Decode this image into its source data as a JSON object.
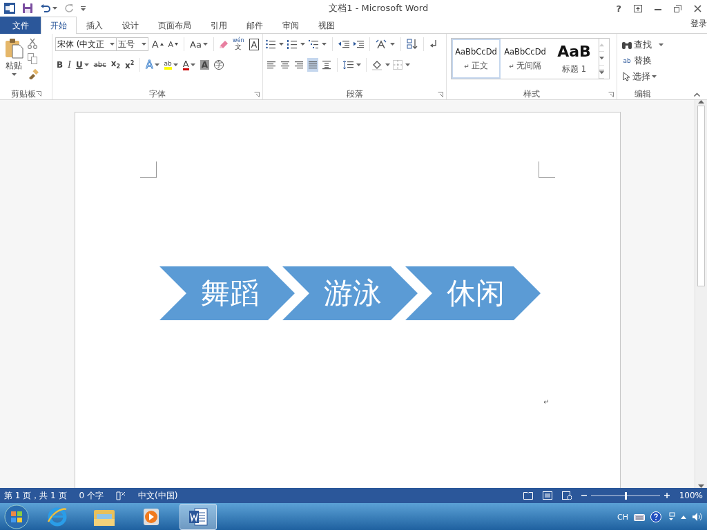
{
  "title_bar": {
    "title": "文档1 - Microsoft Word",
    "help": "?"
  },
  "tabs": [
    {
      "label": "文件",
      "kind": "file",
      "selected": false
    },
    {
      "label": "开始",
      "kind": "tab",
      "selected": true
    },
    {
      "label": "插入",
      "kind": "tab",
      "selected": false
    },
    {
      "label": "设计",
      "kind": "tab",
      "selected": false
    },
    {
      "label": "页面布局",
      "kind": "tab",
      "selected": false
    },
    {
      "label": "引用",
      "kind": "tab",
      "selected": false
    },
    {
      "label": "邮件",
      "kind": "tab",
      "selected": false
    },
    {
      "label": "审阅",
      "kind": "tab",
      "selected": false
    },
    {
      "label": "视图",
      "kind": "tab",
      "selected": false
    }
  ],
  "sign_in": "登录",
  "ribbon": {
    "clipboard": {
      "paste": "粘贴",
      "label": "剪贴板"
    },
    "font": {
      "font_name": "宋体 (中文正",
      "font_size": "五号",
      "label": "字体",
      "row1": [
        {
          "kind": "grow",
          "label": "A"
        },
        {
          "kind": "shrink",
          "label": "A"
        },
        {
          "kind": "case",
          "label": "Aa"
        },
        {
          "kind": "eraser"
        },
        {
          "kind": "phonetic",
          "label": "wén",
          "sub": "文"
        },
        {
          "kind": "border",
          "label": "A"
        }
      ],
      "row2": [
        {
          "kind": "bold",
          "label": "B"
        },
        {
          "kind": "italic",
          "label": "I"
        },
        {
          "kind": "underline",
          "label": "U"
        },
        {
          "kind": "strike",
          "label": "abc"
        },
        {
          "kind": "sub",
          "label": "x",
          "sub": "2"
        },
        {
          "kind": "sup",
          "label": "x",
          "sub": "2"
        },
        {
          "kind": "effects",
          "label": "A"
        },
        {
          "kind": "highlight",
          "label": "ab"
        },
        {
          "kind": "color",
          "label": "A"
        },
        {
          "kind": "shade",
          "label": "A"
        },
        {
          "kind": "enclose",
          "label": "字"
        }
      ]
    },
    "paragraph": {
      "label": "段落",
      "align": [
        {
          "selected": false
        },
        {
          "selected": false
        },
        {
          "selected": false
        },
        {
          "selected": true
        },
        {
          "selected": false
        }
      ]
    },
    "styles": {
      "label": "样式",
      "items": [
        {
          "preview": "AaBbCcDd",
          "name": "正文",
          "mark": "↵",
          "kind": "normal",
          "selected": true
        },
        {
          "preview": "AaBbCcDd",
          "name": "无间隔",
          "mark": "↵",
          "kind": "normal",
          "selected": false
        },
        {
          "preview": "AaB",
          "name": "标题 1",
          "kind": "heading",
          "selected": false
        }
      ]
    },
    "editing": {
      "label": "编辑",
      "find": "查找",
      "replace": "替换",
      "replace_icon": "ab",
      "select": "选择"
    }
  },
  "document": {
    "chevrons": [
      {
        "label": "舞蹈"
      },
      {
        "label": "游泳"
      },
      {
        "label": "休闲"
      }
    ],
    "color": "#5b9bd5",
    "paragraph_mark": "↵"
  },
  "status_bar": {
    "page": "第 1 页，共 1 页",
    "words": "0 个字",
    "language": "中文(中国)",
    "zoom": "100%",
    "level": 0.5
  },
  "taskbar": {
    "apps": [
      {
        "selected": false
      },
      {
        "selected": false
      },
      {
        "selected": false
      },
      {
        "selected": true
      }
    ],
    "input": "CH"
  }
}
